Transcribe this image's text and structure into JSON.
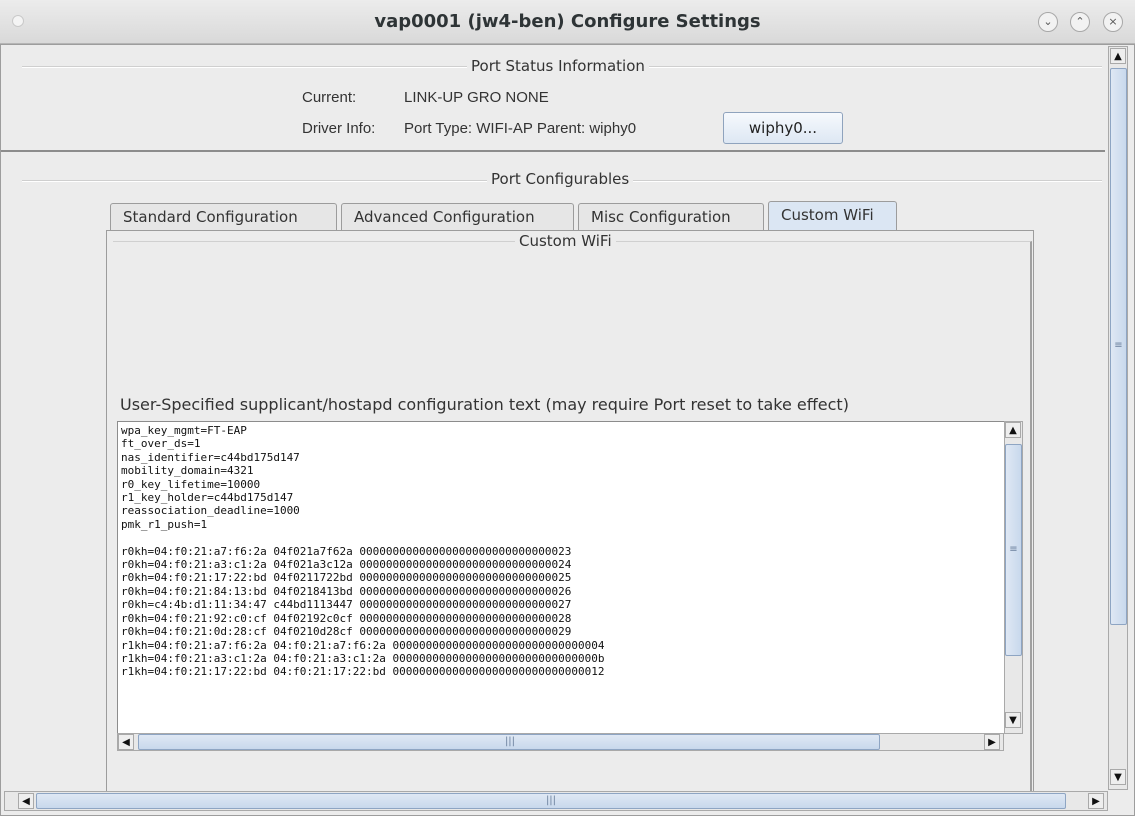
{
  "window": {
    "title": "vap0001  (jw4-ben) Configure Settings",
    "buttons": {
      "minimize": "⌄",
      "maximize": "⌃",
      "close": "×"
    }
  },
  "port_status": {
    "section_title": "Port Status Information",
    "current_label": "Current:",
    "current_value": "LINK-UP GRO  NONE",
    "driver_label": "Driver Info:",
    "driver_value": "Port Type: WIFI-AP   Parent: wiphy0",
    "parent_button": "wiphy0..."
  },
  "port_config": {
    "section_title": "Port Configurables",
    "tabs": [
      {
        "label": "Standard Configuration"
      },
      {
        "label": "Advanced Configuration"
      },
      {
        "label": "Misc Configuration"
      },
      {
        "label": "Custom WiFi"
      }
    ],
    "active_tab": "Custom WiFi",
    "panel_title": "Custom WiFi",
    "textarea_label": "User-Specified supplicant/hostapd configuration text (may require Port reset to take effect)",
    "textarea_value": "wpa_key_mgmt=FT-EAP\nft_over_ds=1\nnas_identifier=c44bd175d147\nmobility_domain=4321\nr0_key_lifetime=10000\nr1_key_holder=c44bd175d147\nreassociation_deadline=1000\npmk_r1_push=1\n\nr0kh=04:f0:21:a7:f6:2a 04f021a7f62a 00000000000000000000000000000023\nr0kh=04:f0:21:a3:c1:2a 04f021a3c12a 00000000000000000000000000000024\nr0kh=04:f0:21:17:22:bd 04f0211722bd 00000000000000000000000000000025\nr0kh=04:f0:21:84:13:bd 04f0218413bd 00000000000000000000000000000026\nr0kh=c4:4b:d1:11:34:47 c44bd1113447 00000000000000000000000000000027\nr0kh=04:f0:21:92:c0:cf 04f02192c0cf 00000000000000000000000000000028\nr0kh=04:f0:21:0d:28:cf 04f0210d28cf 00000000000000000000000000000029\nr1kh=04:f0:21:a7:f6:2a 04:f0:21:a7:f6:2a 00000000000000000000000000000004\nr1kh=04:f0:21:a3:c1:2a 04:f0:21:a3:c1:2a 0000000000000000000000000000000b\nr1kh=04:f0:21:17:22:bd 04:f0:21:17:22:bd 00000000000000000000000000000012"
  },
  "icons": {
    "arrow_up": "▲",
    "arrow_down": "▼",
    "arrow_left": "◀",
    "arrow_right": "▶",
    "grip_v": "≡",
    "grip_h": "|||"
  },
  "colors": {
    "tab_active": "#dbe6f3",
    "button_border": "#8fa3bd",
    "window_bg": "#ececec"
  }
}
